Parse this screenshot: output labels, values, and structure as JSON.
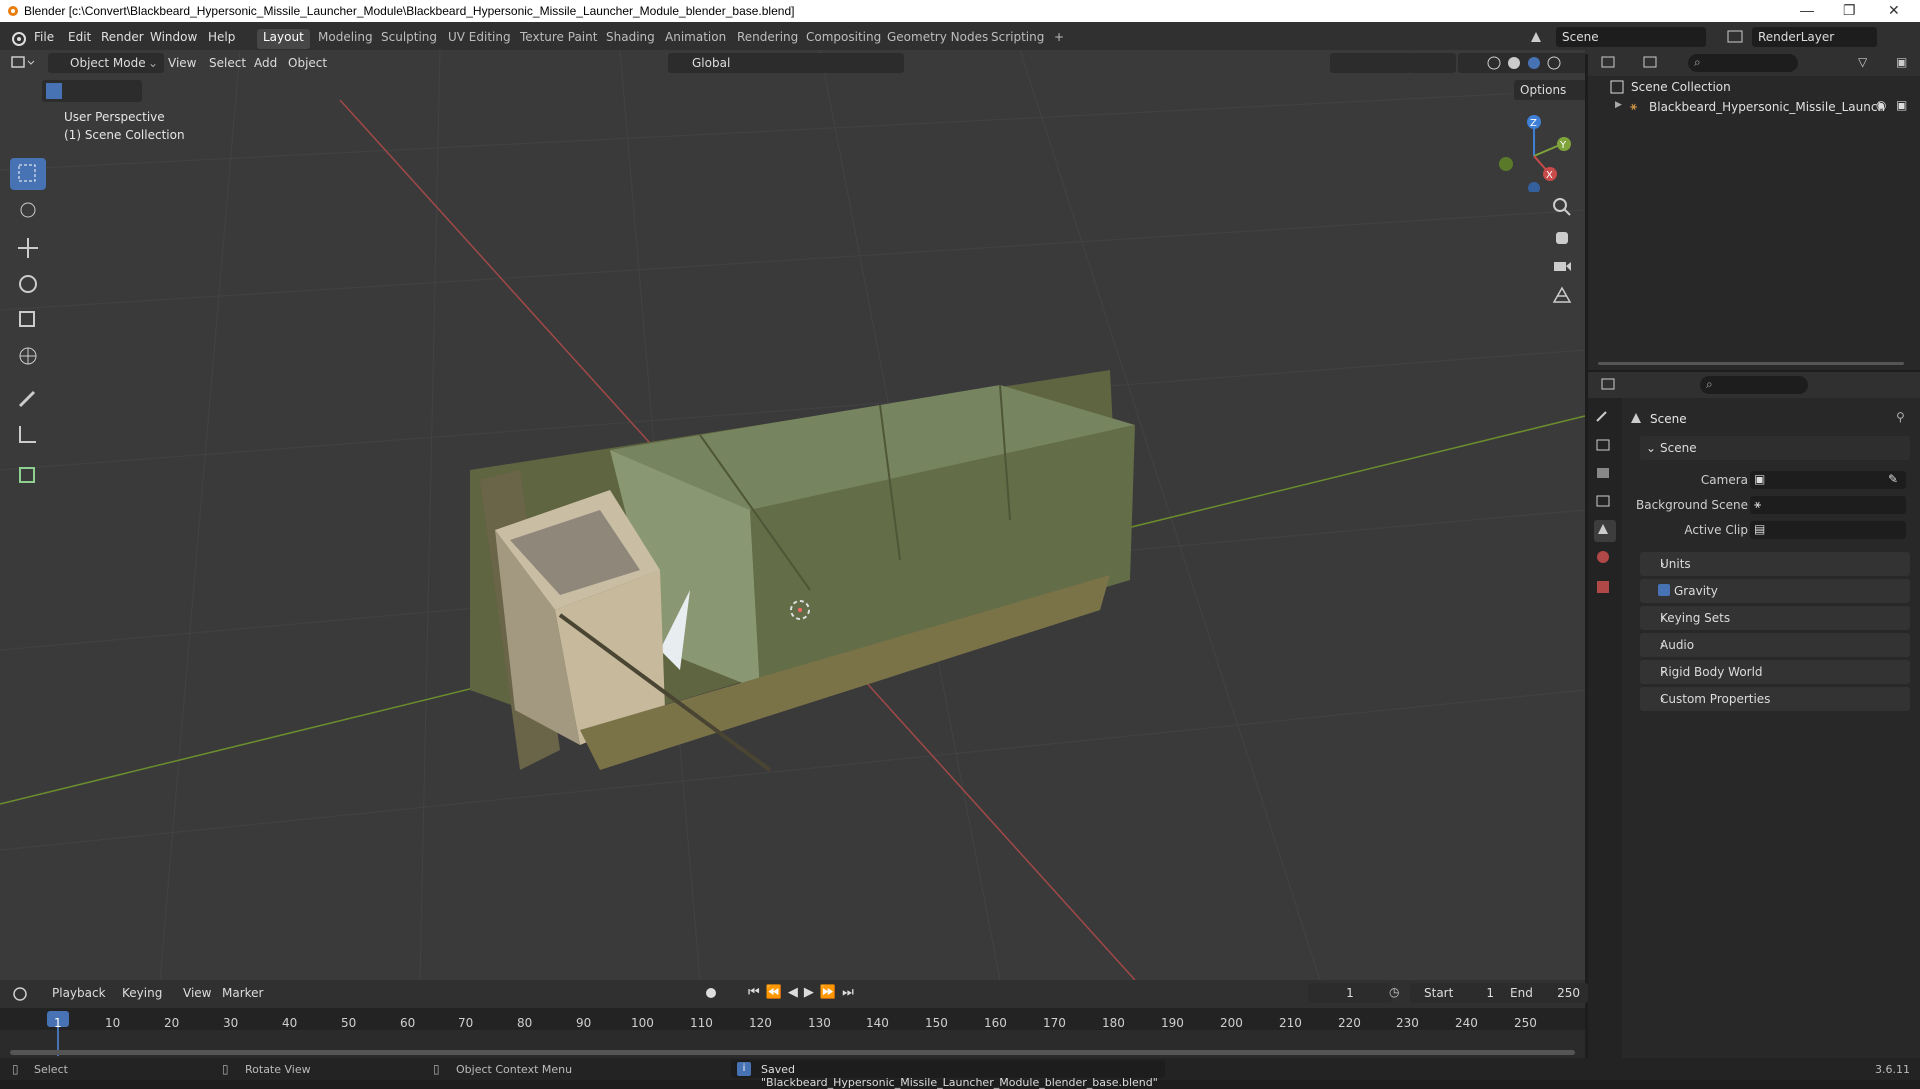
{
  "title_bar": {
    "text": "Blender [c:\\Convert\\Blackbeard_Hypersonic_Missile_Launcher_Module\\Blackbeard_Hypersonic_Missile_Launcher_Module_blender_base.blend]",
    "minimize": "—",
    "maximize": "❐",
    "close": "✕"
  },
  "menu": {
    "items": [
      "File",
      "Edit",
      "Render",
      "Window",
      "Help"
    ]
  },
  "workspaces": [
    "Layout",
    "Modeling",
    "Sculpting",
    "UV Editing",
    "Texture Paint",
    "Shading",
    "Animation",
    "Rendering",
    "Compositing",
    "Geometry Nodes",
    "Scripting",
    "+"
  ],
  "scene_selector": {
    "value": "Scene"
  },
  "renderlayer_selector": {
    "value": "RenderLayer"
  },
  "viewport": {
    "mode": "Object Mode",
    "menus": [
      "View",
      "Select",
      "Add",
      "Object"
    ],
    "orientation": "Global",
    "options": "Options",
    "overlay_line1": "User Perspective",
    "overlay_line2": "(1) Scene Collection",
    "gizmo": {
      "x": "X",
      "y": "Y",
      "z": "Z"
    }
  },
  "outliner": {
    "root": "Scene Collection",
    "child": "Blackbeard_Hypersonic_Missile_Launch"
  },
  "properties": {
    "header": "Scene",
    "section": "Scene",
    "camera_label": "Camera",
    "background_label": "Background Scene",
    "active_clip_label": "Active Clip",
    "panels": [
      "Units",
      "Gravity",
      "Keying Sets",
      "Audio",
      "Rigid Body World",
      "Custom Properties"
    ]
  },
  "timeline": {
    "menus": [
      "Playback",
      "Keying",
      "View",
      "Marker"
    ],
    "current_frame": "1",
    "start_label": "Start",
    "start": "1",
    "end_label": "End",
    "end": "250",
    "ticks": [
      "1",
      "10",
      "20",
      "30",
      "40",
      "50",
      "60",
      "70",
      "80",
      "90",
      "100",
      "110",
      "120",
      "130",
      "140",
      "150",
      "160",
      "170",
      "180",
      "190",
      "200",
      "210",
      "220",
      "230",
      "240",
      "250"
    ]
  },
  "status": {
    "select": "Select",
    "rotate": "Rotate View",
    "context": "Object Context Menu",
    "saved": "Saved \"Blackbeard_Hypersonic_Missile_Launcher_Module_blender_base.blend\"",
    "version": "3.6.11"
  },
  "colors": {
    "accent": "#4772b3",
    "x_axis": "#c94a4a",
    "y_axis": "#7ea33a",
    "z_axis": "#3f7fd6"
  }
}
